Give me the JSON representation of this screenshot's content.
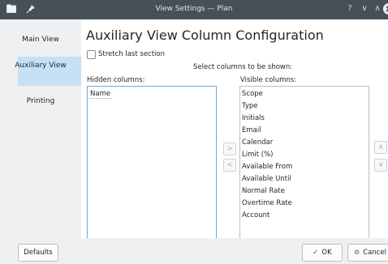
{
  "window": {
    "title": "View Settings — Plan",
    "help_glyph": "?",
    "min_glyph": "∨",
    "max_glyph": "∧",
    "close_glyph": "✕"
  },
  "sidebar": {
    "items": [
      {
        "label": "Main View"
      },
      {
        "label": "Auxiliary View",
        "selected": true
      },
      {
        "label": "Printing"
      }
    ]
  },
  "main": {
    "title": "Auxiliary View Column Configuration",
    "stretch_label": "Stretch last section",
    "stretch_checked": false,
    "select_label": "Select columns to be shown:",
    "hidden_label": "Hidden columns:",
    "visible_label": "Visible columns:",
    "hidden_columns": [
      "Name"
    ],
    "visible_columns": [
      "Scope",
      "Type",
      "Initials",
      "Email",
      "Calendar",
      "Limit (%)",
      "Available From",
      "Available Until",
      "Normal Rate",
      "Overtime Rate",
      "Account"
    ]
  },
  "buttons": {
    "add_glyph": ">",
    "remove_glyph": "<",
    "up_glyph": "∧",
    "down_glyph": "∨",
    "defaults": "Defaults",
    "ok": "OK",
    "cancel": "Cancel"
  },
  "icons": {
    "app": "folder-icon",
    "pin": "pin-icon",
    "ok": "check-icon",
    "cancel": "cancel-icon"
  },
  "colors": {
    "titlebar": "#475057",
    "selection": "#c6e0f5",
    "focus": "#6ba9dd"
  }
}
